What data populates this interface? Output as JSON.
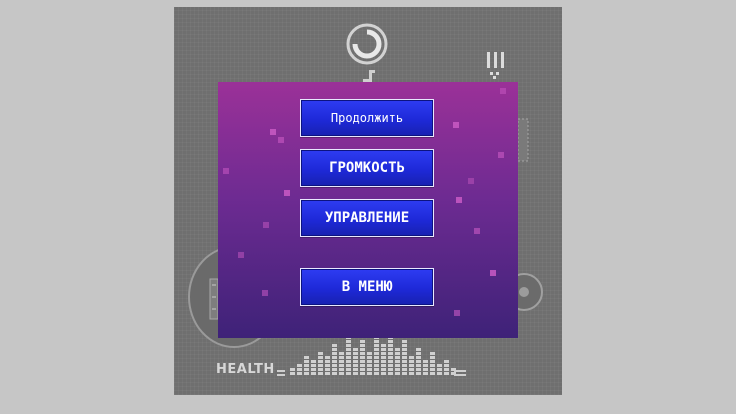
{
  "game": {
    "hud": {
      "health_label": "HEALTH",
      "health_bar_heights": [
        2,
        3,
        5,
        4,
        6,
        5,
        8,
        6,
        10,
        7,
        9,
        6,
        12,
        8,
        10,
        7,
        9,
        5,
        7,
        4,
        6,
        3,
        4,
        2
      ],
      "pause_icon": "pause-bars-icon",
      "timer_icon": "circular-timer-icon",
      "music_icon": "music-note-icon"
    },
    "pause_menu": {
      "continue_label": "Продолжить",
      "volume_label": "ГРОМКОСТЬ",
      "controls_label": "УПРАВЛЕНИЕ",
      "to_menu_label": "В МЕНЮ"
    },
    "colors": {
      "overlay_top": "#9b3198",
      "overlay_bottom": "#3e2278",
      "button_blue": "#1e29d8",
      "button_border": "#e9e9ff",
      "background_gray": "#6f6f6f"
    }
  }
}
